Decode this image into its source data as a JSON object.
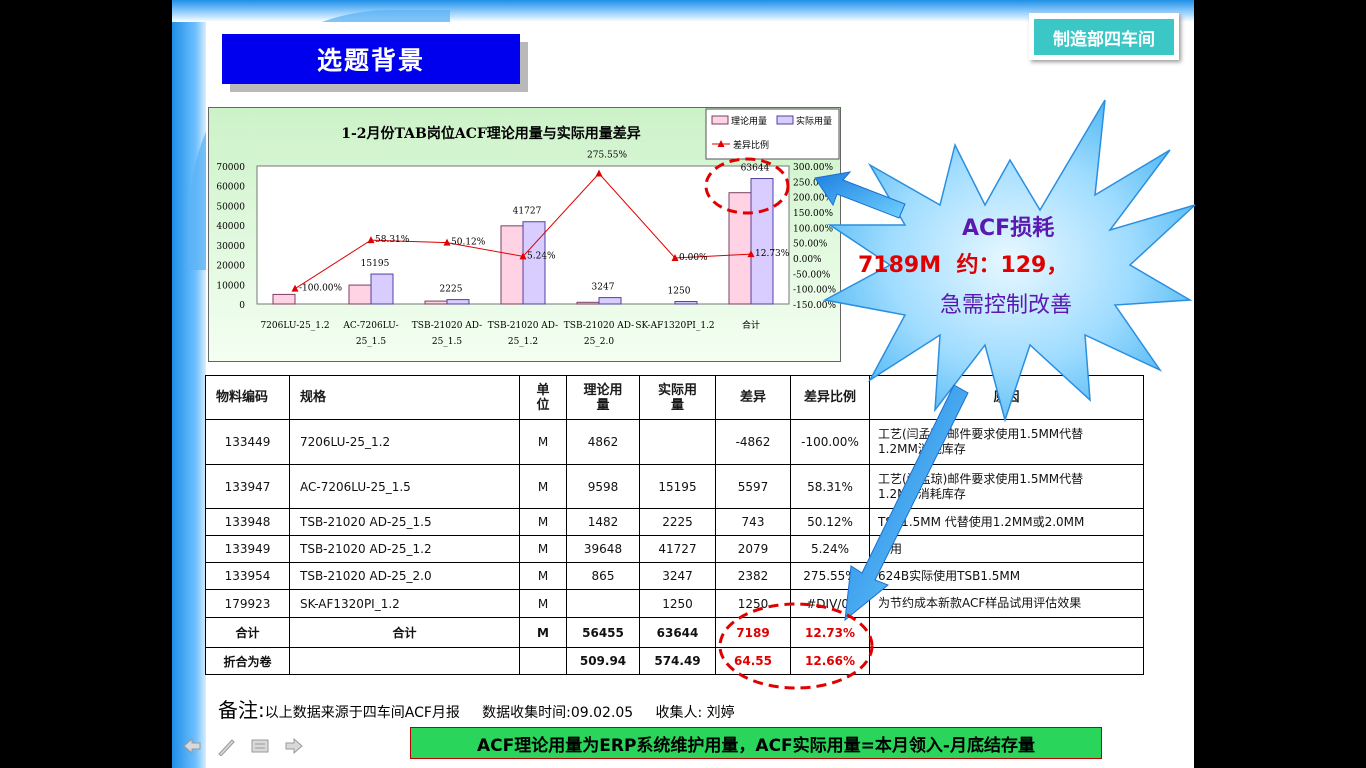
{
  "slide": {
    "title": "选题背景",
    "dept": "制造部四车间"
  },
  "chart_data": {
    "type": "bar",
    "title": "1-2月份TAB岗位ACF理论用量与实际用量差异",
    "categories": [
      "7206LU-25_1.2",
      "AC-7206LU-25_1.5",
      "TSB-21020 AD-25_1.5",
      "TSB-21020 AD-25_1.2",
      "TSB-21020 AD-25_2.0",
      "SK-AF1320PI_1.2",
      "合计"
    ],
    "category_lines": [
      [
        "7206LU-25_1.2",
        ""
      ],
      [
        "AC-7206LU-",
        "25_1.5"
      ],
      [
        "TSB-21020 AD-",
        "25_1.5"
      ],
      [
        "TSB-21020 AD-",
        "25_1.2"
      ],
      [
        "TSB-21020 AD-",
        "25_2.0"
      ],
      [
        "SK-AF1320PI_1.2",
        ""
      ],
      [
        "合计",
        ""
      ]
    ],
    "series": [
      {
        "name": "理论用量",
        "values": [
          4862,
          9598,
          1482,
          39648,
          865,
          0,
          56455
        ],
        "color": "#ffd2e4"
      },
      {
        "name": "实际用量",
        "values": [
          0,
          15195,
          2225,
          41727,
          3247,
          1250,
          63644
        ],
        "color": "#d9ccff"
      },
      {
        "name": "差异比例",
        "values": [
          -100.0,
          58.31,
          50.12,
          5.24,
          275.55,
          0.0,
          12.73
        ],
        "color": "#e00000"
      }
    ],
    "bar_labels": [
      "",
      "15195",
      "2225",
      "41727",
      "3247",
      "1250",
      "63644"
    ],
    "line_labels": [
      "-100.00%",
      "58.31%",
      "50.12%",
      "5.24%",
      "275.55%",
      "0.00%",
      "12.73%"
    ],
    "ylim": [
      0,
      70000
    ],
    "yticks": [
      "70000",
      "60000",
      "50000",
      "40000",
      "30000",
      "20000",
      "10000",
      "0"
    ],
    "y2lim": [
      -150,
      300
    ],
    "y2ticks": [
      "300.00%",
      "250.00%",
      "200.00%",
      "150.00%",
      "100.00%",
      "50.00%",
      "0.00%",
      "-50.00%",
      "-100.00%",
      "-150.00%"
    ],
    "legend_position": "top-right"
  },
  "table": {
    "headers": [
      "物料编码",
      "规格",
      "单位",
      "理论用量",
      "实际用量",
      "差异",
      "差异比例",
      "原因"
    ],
    "header_lines": {
      "unit": [
        "单",
        "位"
      ],
      "theory": [
        "理论用",
        "量"
      ],
      "actual": [
        "实际用",
        "量"
      ]
    },
    "rows": [
      {
        "code": "133449",
        "spec": "7206LU-25_1.2",
        "unit": "M",
        "theory": "4862",
        "actual": "",
        "diff": "-4862",
        "ratio": "-100.00%",
        "reason": [
          "工艺(闫孟琼)邮件要求使用1.5MM代替",
          "1.2MM消耗库存"
        ]
      },
      {
        "code": "133947",
        "spec": "AC-7206LU-25_1.5",
        "unit": "M",
        "theory": "9598",
        "actual": "15195",
        "diff": "5597",
        "ratio": "58.31%",
        "reason": [
          "工艺(闫孟琼)邮件要求使用1.5MM代替",
          "1.2MM消耗库存"
        ]
      },
      {
        "code": "133948",
        "spec": "TSB-21020 AD-25_1.5",
        "unit": "M",
        "theory": "1482",
        "actual": "2225",
        "diff": "743",
        "ratio": "50.12%",
        "reason": [
          "TSB1.5MM 代替使用1.2MM或2.0MM"
        ]
      },
      {
        "code": "133949",
        "spec": "TSB-21020 AD-25_1.2",
        "unit": "M",
        "theory": "39648",
        "actual": "41727",
        "diff": "2079",
        "ratio": "5.24%",
        "reason": [
          "多用"
        ]
      },
      {
        "code": "133954",
        "spec": "TSB-21020 AD-25_2.0",
        "unit": "M",
        "theory": "865",
        "actual": "3247",
        "diff": "2382",
        "ratio": "275.55%",
        "reason": [
          "624B实际使用TSB1.5MM"
        ]
      },
      {
        "code": "179923",
        "spec": "SK-AF1320PI_1.2",
        "unit": "M",
        "theory": "",
        "actual": "1250",
        "diff": "1250",
        "ratio": "#DIV/0!",
        "reason": [
          "为节约成本新款ACF样品试用评估效果"
        ]
      }
    ],
    "total": {
      "code": "合计",
      "spec": "合计",
      "unit": "M",
      "theory": "56455",
      "actual": "63644",
      "diff": "7189",
      "ratio": "12.73%"
    },
    "rolls": {
      "code": "折合为卷",
      "spec": "",
      "unit": "",
      "theory": "509.94",
      "actual": "574.49",
      "diff": "64.55",
      "ratio": "12.66%"
    }
  },
  "note": {
    "prefix": "备注:",
    "text": "以上数据来源于四车间ACF月报     数据收集时间:09.02.05     收集人: 刘婷"
  },
  "callout": {
    "line1": "ACF损耗",
    "line2": "7189M  约：129，",
    "line3": "急需控制改善"
  },
  "footer": "ACF理论用量为ERP系统维护用量，ACF实际用量=本月领入-月底结存量",
  "colors": {
    "title_bg": "#0000ee",
    "badge_bg": "#3cc7c7",
    "footer_bg": "#2ad55b",
    "star_fill": "#6ec8f5",
    "highlight_red": "#e00000"
  },
  "icons": [
    "prev-arrow-icon",
    "pen-icon",
    "menu-icon",
    "next-arrow-icon"
  ]
}
